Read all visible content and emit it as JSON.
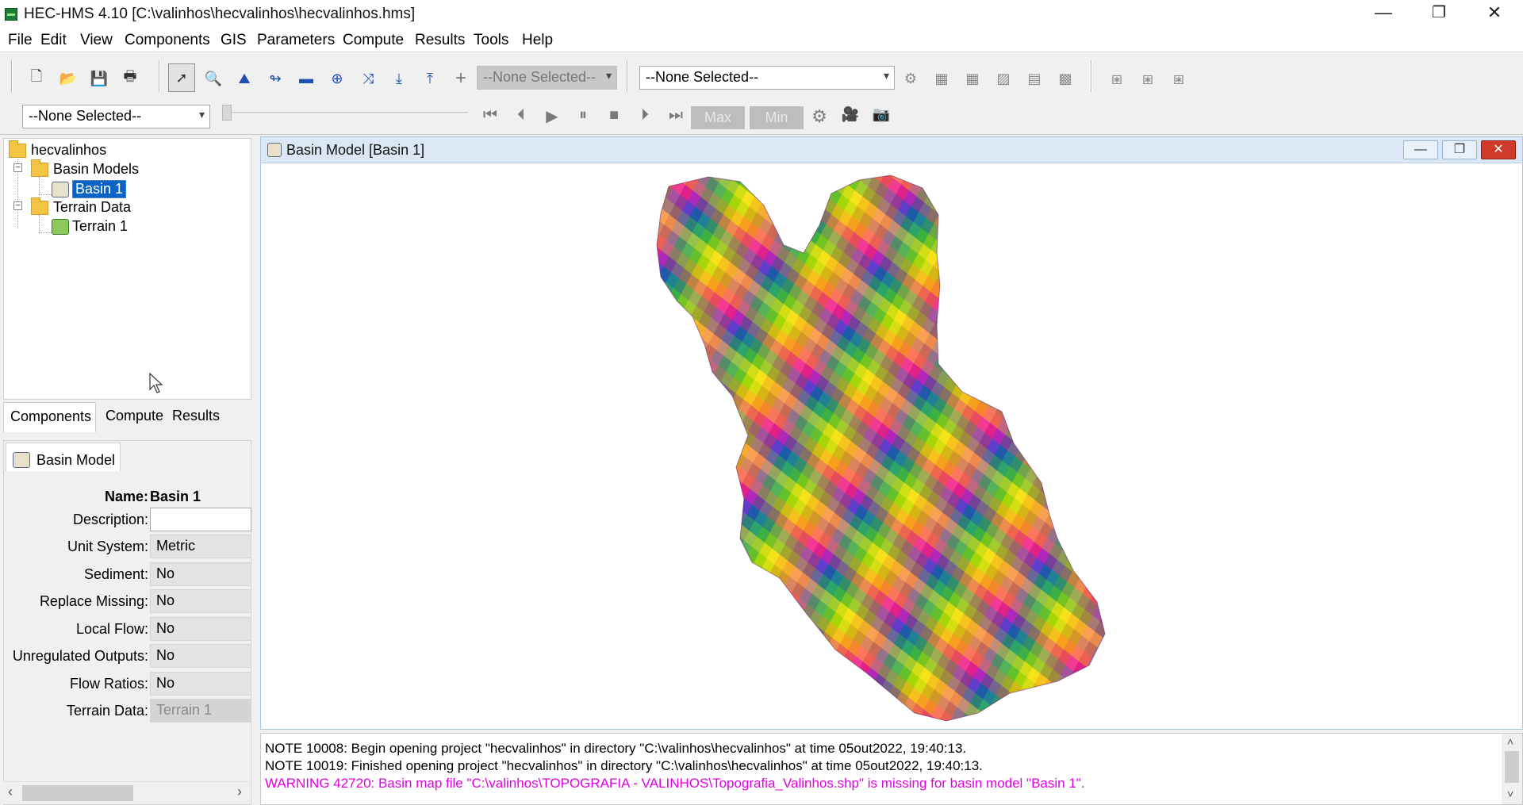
{
  "window": {
    "title": "HEC-HMS 4.10 [C:\\valinhos\\hecvalinhos\\hecvalinhos.hms]",
    "minimize": "—",
    "maximize": "❐",
    "close": "✕"
  },
  "menu": [
    "File",
    "Edit",
    "View",
    "Components",
    "GIS",
    "Parameters",
    "Compute",
    "Results",
    "Tools",
    "Help"
  ],
  "toolbar": {
    "buttons": [
      {
        "icon": "new-file-icon",
        "glyph": "🗋"
      },
      {
        "icon": "open-folder-icon",
        "glyph": "📂"
      },
      {
        "icon": "save-icon",
        "glyph": "💾"
      },
      {
        "icon": "print-icon",
        "glyph": "🖶"
      },
      {
        "icon": "select-arrow-icon",
        "glyph": "➚"
      },
      {
        "icon": "zoom-icon",
        "glyph": "🔍"
      },
      {
        "icon": "subbasin-tool-icon",
        "glyph": "⛰"
      },
      {
        "icon": "reach-tool-icon",
        "glyph": "↬"
      },
      {
        "icon": "reservoir-tool-icon",
        "glyph": "▬"
      },
      {
        "icon": "junction-tool-icon",
        "glyph": "⊕"
      },
      {
        "icon": "diversion-tool-icon",
        "glyph": "⤨"
      },
      {
        "icon": "source-tool-icon",
        "glyph": "⤓"
      },
      {
        "icon": "sink-tool-icon",
        "glyph": "⤒"
      },
      {
        "icon": "crosshair-icon",
        "glyph": "+"
      }
    ],
    "element_combo": "--None Selected--",
    "results_combo": "--None Selected--",
    "results_buttons": [
      "⚙",
      "▦",
      "▦",
      "▨",
      "▤",
      "▩"
    ],
    "grid_buttons": [
      "⧆",
      "⧆",
      "⧆"
    ],
    "time_combo": "--None Selected--",
    "playback": [
      "⏮",
      "⏴",
      "▶",
      "⏸",
      "■",
      "⏵",
      "⏭"
    ],
    "max_label": "Max",
    "min_label": "Min",
    "settings_glyph": "⚙",
    "camera_glyphs": [
      "🎥",
      "📷"
    ]
  },
  "tree": {
    "root": "hecvalinhos",
    "basin_models": "Basin Models",
    "basin": "Basin 1",
    "terrain_data": "Terrain Data",
    "terrain": "Terrain 1"
  },
  "tabs": [
    "Components",
    "Compute",
    "Results"
  ],
  "properties": {
    "tab": "Basin Model",
    "name_label": "Name:",
    "name_value": "Basin 1",
    "rows": [
      {
        "label": "Description:",
        "value": ""
      },
      {
        "label": "Unit System:",
        "value": "Metric"
      },
      {
        "label": "Sediment:",
        "value": "No"
      },
      {
        "label": "Replace Missing:",
        "value": "No"
      },
      {
        "label": "Local Flow:",
        "value": "No"
      },
      {
        "label": "Unregulated Outputs:",
        "value": "No"
      },
      {
        "label": "Flow Ratios:",
        "value": "No"
      },
      {
        "label": "Terrain Data:",
        "value": "Terrain 1"
      }
    ]
  },
  "map_window": {
    "title": "Basin Model [Basin 1]"
  },
  "console": [
    {
      "text": "NOTE 10008:  Begin opening project \"hecvalinhos\" in directory \"C:\\valinhos\\hecvalinhos\" at time 05out2022, 19:40:13.",
      "type": "note"
    },
    {
      "text": "NOTE 10019:  Finished opening project \"hecvalinhos\" in directory \"C:\\valinhos\\hecvalinhos\" at time 05out2022, 19:40:13.",
      "type": "note"
    },
    {
      "text": "WARNING 42720:  Basin map file \"C:\\valinhos\\TOPOGRAFIA - VALINHOS\\Topografia_Valinhos.shp\" is missing for basin model \"Basin 1\".",
      "type": "warning"
    }
  ],
  "colors": {
    "selection": "#0a64c8",
    "warning": "#e100e1",
    "terrain_palette": [
      "#e0218a",
      "#8a2be2",
      "#1e5aa8",
      "#1f9a8a",
      "#3cb043",
      "#a6d608",
      "#f5e21b",
      "#f7a01d",
      "#f06d3b",
      "#ff4f9a"
    ]
  }
}
